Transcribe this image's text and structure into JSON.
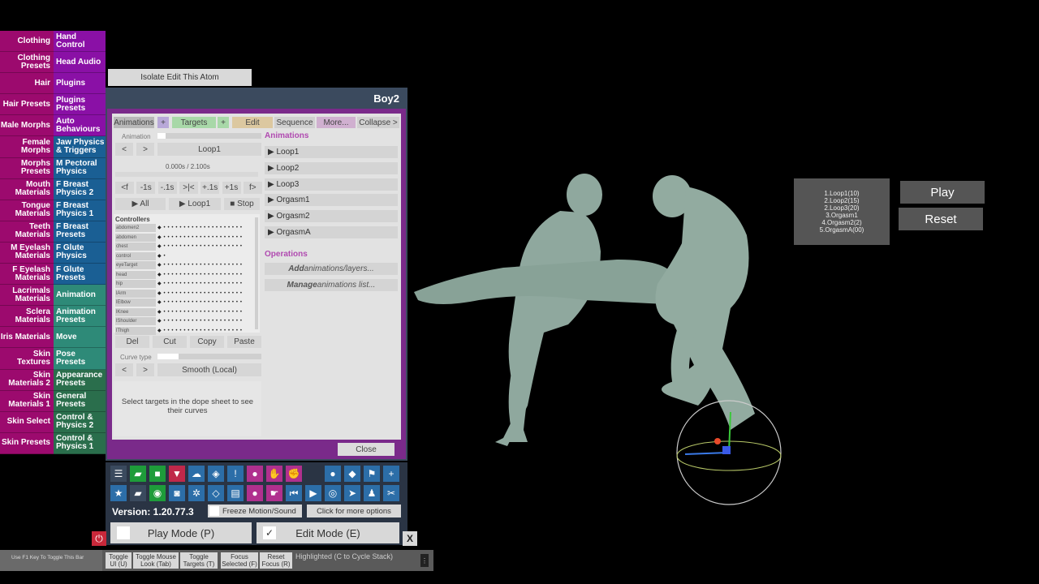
{
  "left_tabs": [
    "Clothing",
    "Clothing Presets",
    "Hair",
    "Hair Presets",
    "Male Morphs",
    "Female Morphs",
    "Morphs Presets",
    "Mouth Materials",
    "Tongue Materials",
    "Teeth Materials",
    "M Eyelash Materials",
    "F Eyelash Materials",
    "Lacrimals Materials",
    "Sclera Materials",
    "Iris Materials",
    "Skin Textures",
    "Skin Materials 2",
    "Skin Materials 1",
    "Skin Select",
    "Skin Presets"
  ],
  "right_tabs": [
    {
      "label": "Hand Control",
      "color": "#8a10a6"
    },
    {
      "label": "Head Audio",
      "color": "#8a10a6"
    },
    {
      "label": "Plugins",
      "color": "#8a10a6"
    },
    {
      "label": "Plugins Presets",
      "color": "#8a10a6"
    },
    {
      "label": "Auto Behaviours",
      "color": "#8a10a6"
    },
    {
      "label": "Jaw Physics & Triggers",
      "color": "#1a5f94"
    },
    {
      "label": "M Pectoral Physics",
      "color": "#1a5f94"
    },
    {
      "label": "F Breast Physics 2",
      "color": "#1a5f94"
    },
    {
      "label": "F Breast Physics 1",
      "color": "#1a5f94"
    },
    {
      "label": "F Breast Presets",
      "color": "#1a5f94"
    },
    {
      "label": "F Glute Physics",
      "color": "#1a5f94"
    },
    {
      "label": "F Glute Presets",
      "color": "#1a5f94"
    },
    {
      "label": "Animation",
      "color": "#2e8a78"
    },
    {
      "label": "Animation Presets",
      "color": "#2e8a78"
    },
    {
      "label": "Move",
      "color": "#2e8a78"
    },
    {
      "label": "Pose Presets",
      "color": "#2e8a78"
    },
    {
      "label": "Appearance Presets",
      "color": "#2a6e4c"
    },
    {
      "label": "General Presets",
      "color": "#2a6e4c"
    },
    {
      "label": "Control & Physics 2",
      "color": "#2a6e4c"
    },
    {
      "label": "Control & Physics 1",
      "color": "#2a6e4c"
    }
  ],
  "isolate_button": "Isolate Edit This Atom",
  "panel": {
    "title": "Boy2",
    "close": "Close",
    "tabs": {
      "animations": "Animations",
      "add1": "+",
      "targets": "Targets",
      "add2": "+",
      "edit": "Edit",
      "sequence": "Sequence",
      "more": "More...",
      "collapse": "Collapse >"
    },
    "animation_label": "Animation",
    "prev": "<",
    "next": ">",
    "current_animation": "Loop1",
    "time": "0.000s / 2.100s",
    "scrub": [
      "<f",
      "-1s",
      "-.1s",
      ">|<",
      "+.1s",
      "+1s",
      "f>"
    ],
    "play_all": "▶ All",
    "play_loop": "▶ Loop1",
    "stop": "■ Stop",
    "controllers_label": "Controllers",
    "controllers": [
      "abdomen2",
      "abdomen",
      "chest",
      "control",
      "eyeTarget",
      "head",
      "hip",
      "lArm",
      "lElbow",
      "lKnee",
      "lShoulder",
      "lThigh"
    ],
    "edit_buttons": [
      "Del",
      "Cut",
      "Copy",
      "Paste"
    ],
    "curve_type_label": "Curve type",
    "curve_type": "Smooth (Local)",
    "hint": "Select targets in the dope sheet to see their curves",
    "animations_header": "Animations",
    "animations": [
      "▶ Loop1",
      "▶ Loop2",
      "▶ Loop3",
      "▶ Orgasm1",
      "▶ Orgasm2",
      "▶ OrgasmA"
    ],
    "operations_header": "Operations",
    "op_add_bold": "Add",
    "op_add_rest": " animations/layers...",
    "op_manage_bold": "Manage",
    "op_manage_rest": " animations list..."
  },
  "toolbar": {
    "version": "Version: 1.20.77.3",
    "freeze": "Freeze Motion/Sound",
    "more_options": "Click for more options",
    "play_mode": "Play Mode (P)",
    "edit_mode": "Edit Mode (E)",
    "edit_check": "✓",
    "close_x": "X"
  },
  "bottom_bar": {
    "f1_hint": "Use F1 Key To Toggle This Bar",
    "buttons": [
      "Toggle UI (U)",
      "Toggle Mouse Look (Tab)",
      "Toggle Targets (T)",
      "Focus Selected (F)",
      "Reset Focus (R)"
    ],
    "highlighted": "Highlighted (C to Cycle Stack)"
  },
  "sequence_panel": [
    "1.Loop1(10)",
    "2.Loop2(15)",
    "2.Loop3(20)",
    "3.Orgasm1",
    "4.Orgasm2(2)",
    "5.OrgasmA(00)"
  ],
  "play_button": "Play",
  "reset_button": "Reset"
}
